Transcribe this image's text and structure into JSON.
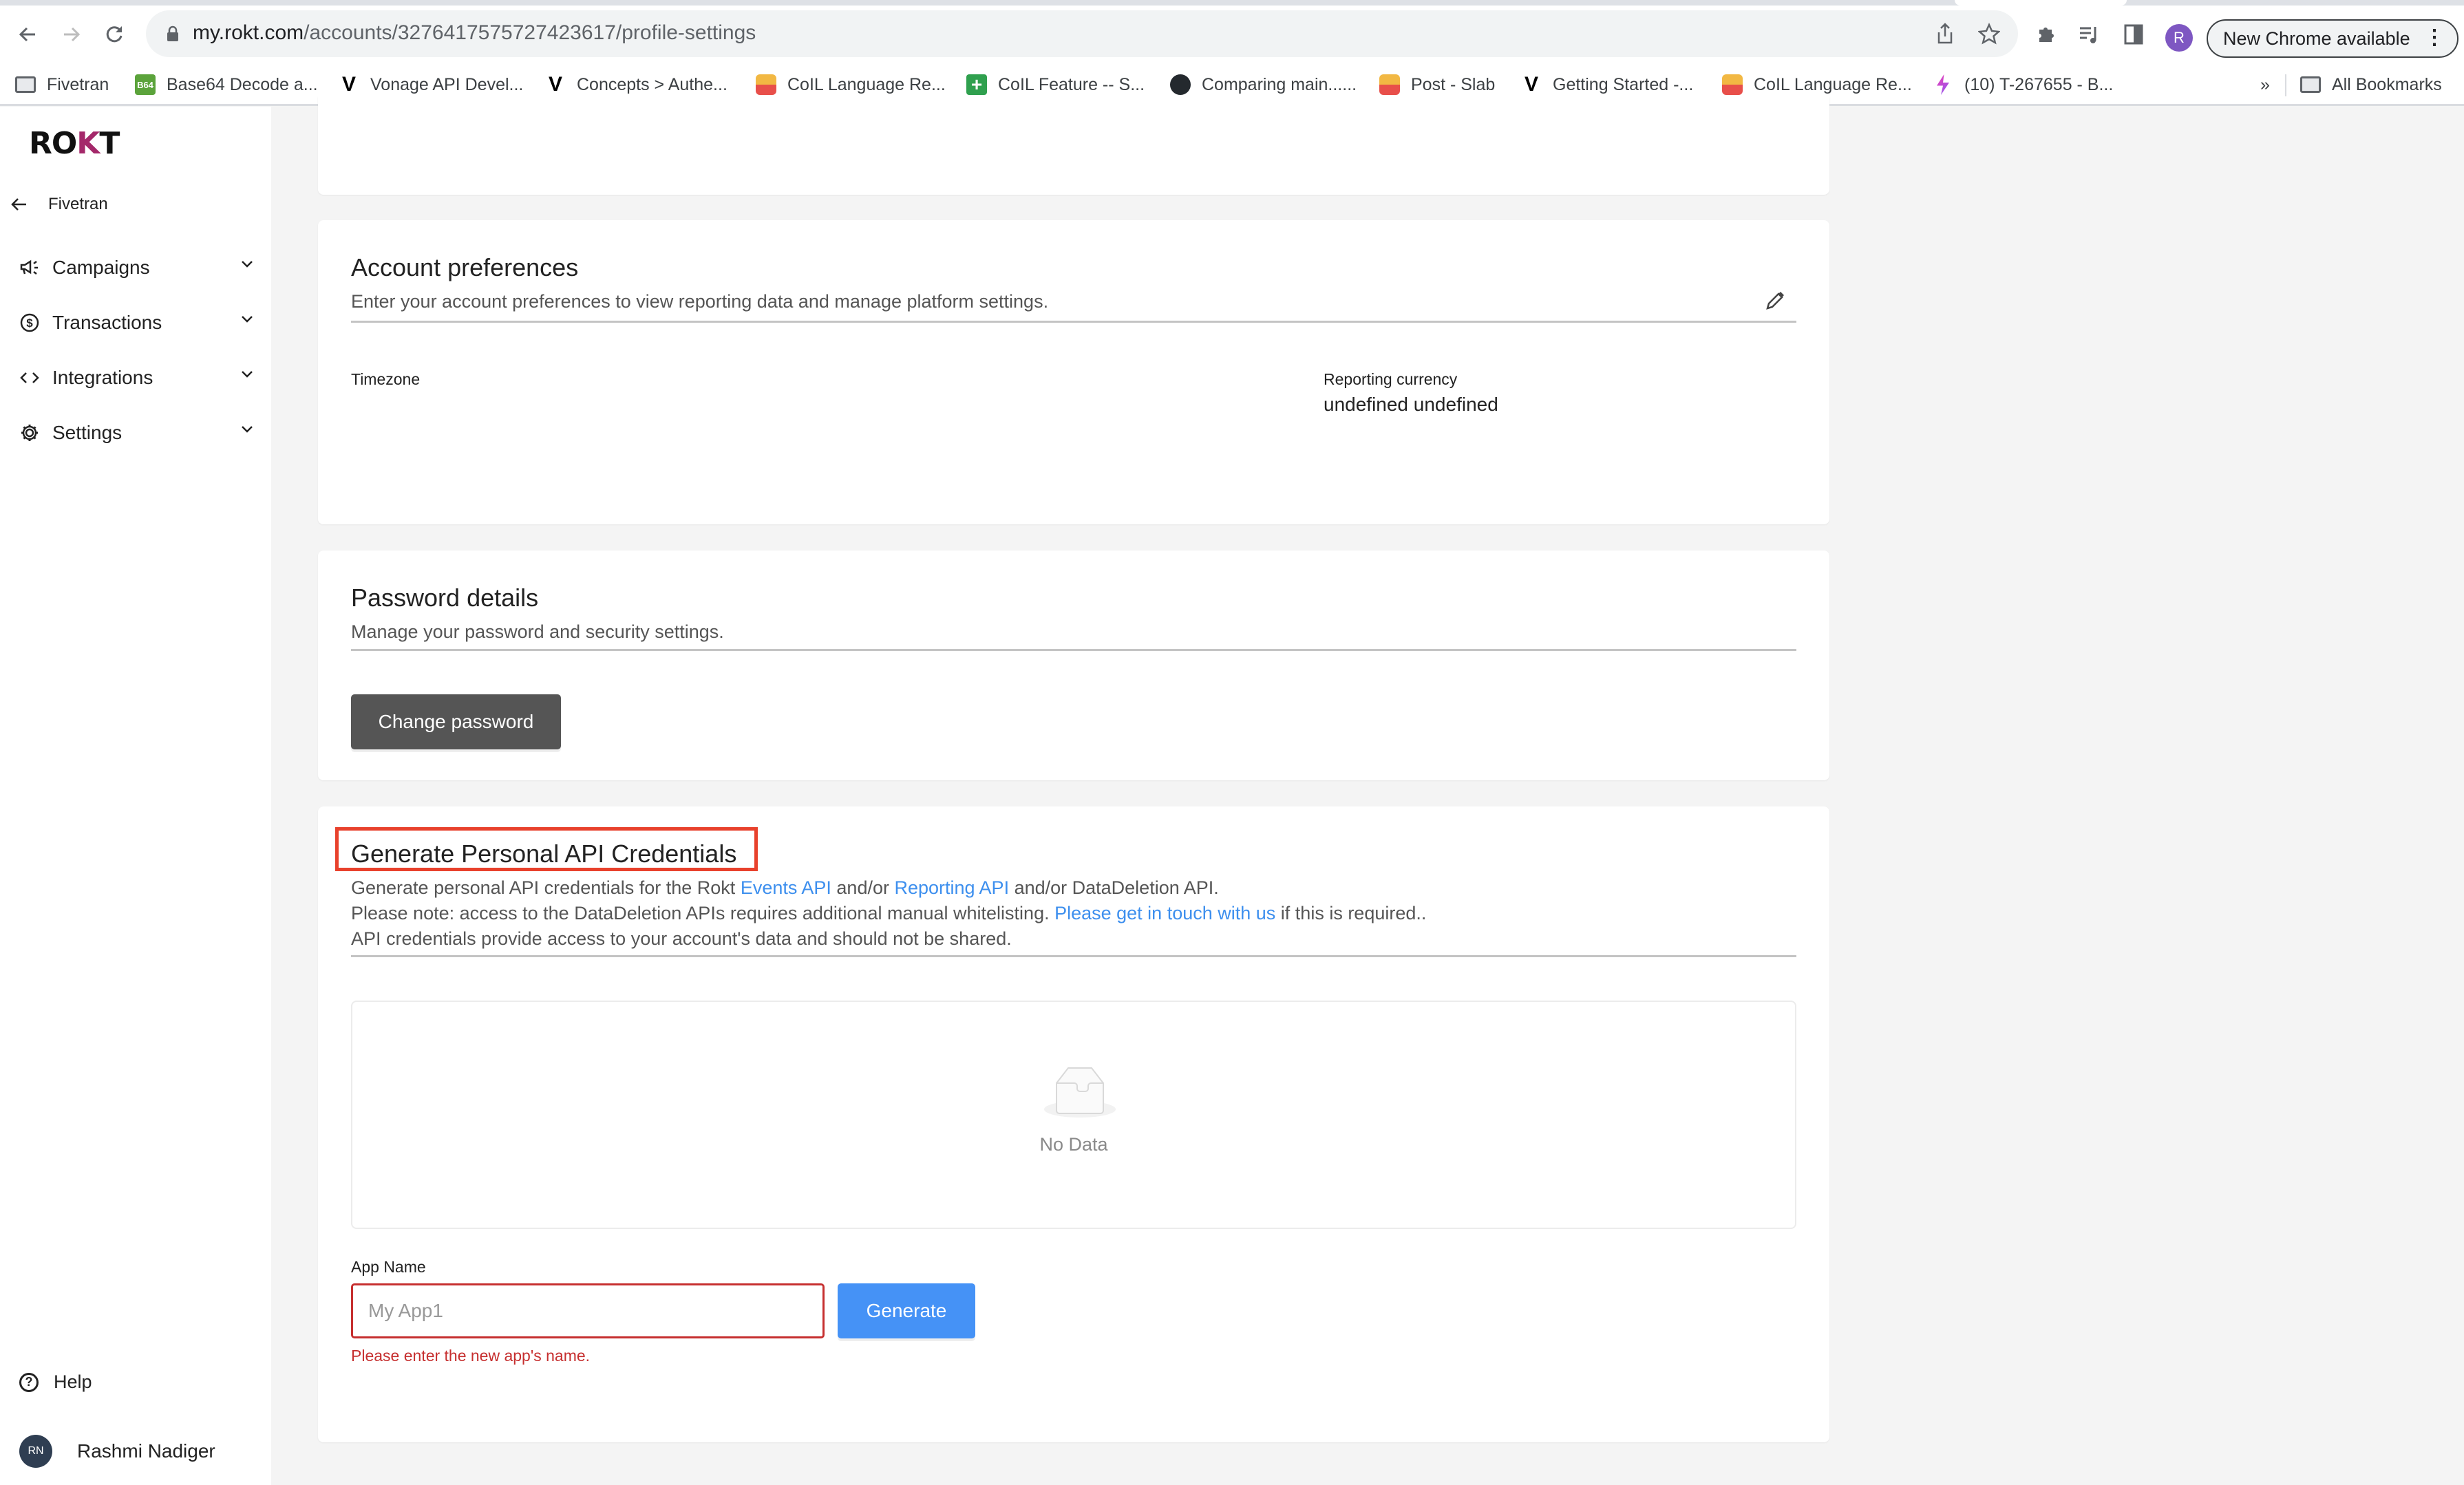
{
  "browser": {
    "url_host": "my.rokt.com",
    "url_path": "/accounts/3276417575727423617/profile-settings",
    "profile_initial": "R",
    "new_chrome_label": "New Chrome available",
    "bookmarks": [
      {
        "label": "Fivetran",
        "icon": "folder"
      },
      {
        "label": "Base64 Decode a...",
        "icon": "b64",
        "icon_text": "B64"
      },
      {
        "label": "Vonage API Devel...",
        "icon": "vonage",
        "icon_text": "V"
      },
      {
        "label": "Concepts > Authe...",
        "icon": "vonage",
        "icon_text": "V"
      },
      {
        "label": "CoIL Language Re...",
        "icon": "slab"
      },
      {
        "label": "CoIL Feature -- S...",
        "icon": "gsheet",
        "icon_text": "+"
      },
      {
        "label": "Comparing main......",
        "icon": "github"
      },
      {
        "label": "Post - Slab",
        "icon": "slab"
      },
      {
        "label": "Getting Started -...",
        "icon": "vonage",
        "icon_text": "V"
      },
      {
        "label": "CoIL Language Re...",
        "icon": "slab"
      },
      {
        "label": "(10) T-267655 - B...",
        "icon": "clickup"
      }
    ],
    "overflow_label": "»",
    "all_bookmarks_label": "All Bookmarks"
  },
  "sidebar": {
    "logo": {
      "pre": "RO",
      "k": "K",
      "post": "T"
    },
    "back_label": "Fivetran",
    "items": [
      {
        "label": "Campaigns",
        "icon": "megaphone-icon"
      },
      {
        "label": "Transactions",
        "icon": "dollar-circle-icon"
      },
      {
        "label": "Integrations",
        "icon": "code-icon"
      },
      {
        "label": "Settings",
        "icon": "gear-icon"
      }
    ],
    "help_label": "Help",
    "user": {
      "initials": "RN",
      "name": "Rashmi Nadiger"
    }
  },
  "account_preferences": {
    "title": "Account preferences",
    "subtitle": "Enter your account preferences to view reporting data and manage platform settings.",
    "timezone_label": "Timezone",
    "timezone_value": "",
    "currency_label": "Reporting currency",
    "currency_value": "undefined undefined"
  },
  "password": {
    "title": "Password details",
    "subtitle": "Manage your password and security settings.",
    "button_label": "Change password"
  },
  "api_credentials": {
    "title": "Generate Personal API Credentials",
    "line1_a": "Generate personal API credentials for the Rokt ",
    "line1_link1": "Events API",
    "line1_b": " and/or ",
    "line1_link2": "Reporting API",
    "line1_c": " and/or DataDeletion API.",
    "line2_a": "Please note: access to the DataDeletion APIs requires additional manual whitelisting. ",
    "line2_link": "Please get in touch with us",
    "line2_b": " if this is required..",
    "line3": "API credentials provide access to your account's data and should not be shared.",
    "empty_text": "No Data",
    "app_name_label": "App Name",
    "app_name_value": "",
    "app_name_placeholder": "My App1",
    "generate_label": "Generate",
    "error_text": "Please enter the new app's name.",
    "colors": {
      "link": "#3d8fee",
      "error": "#c62f2f",
      "primary": "#4592f6",
      "highlight": "#e8412c"
    }
  }
}
